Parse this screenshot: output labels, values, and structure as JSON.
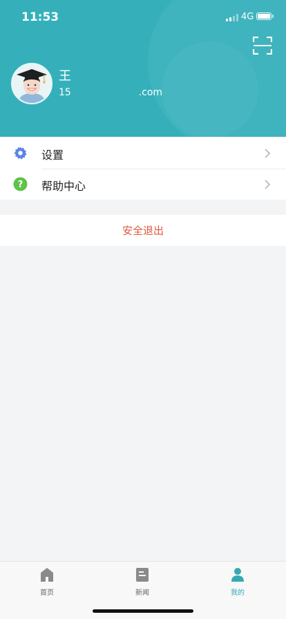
{
  "status_bar": {
    "time": "11:53",
    "network": "4G"
  },
  "profile": {
    "name": "王",
    "email": "15                      .com"
  },
  "menu": {
    "items": [
      {
        "label": "设置",
        "icon": "gear-icon",
        "color": "#5b86e5"
      },
      {
        "label": "帮助中心",
        "icon": "help-icon",
        "color": "#5fc24b"
      }
    ]
  },
  "logout": {
    "label": "安全退出",
    "color": "#e2583f"
  },
  "tabbar": {
    "tabs": [
      {
        "label": "首页",
        "icon": "home-icon",
        "active": false
      },
      {
        "label": "新闻",
        "icon": "news-icon",
        "active": false
      },
      {
        "label": "我的",
        "icon": "profile-icon",
        "active": true
      }
    ]
  },
  "colors": {
    "header": "#35b0bb",
    "active_tab": "#35a9b3",
    "background": "#f3f4f6"
  }
}
